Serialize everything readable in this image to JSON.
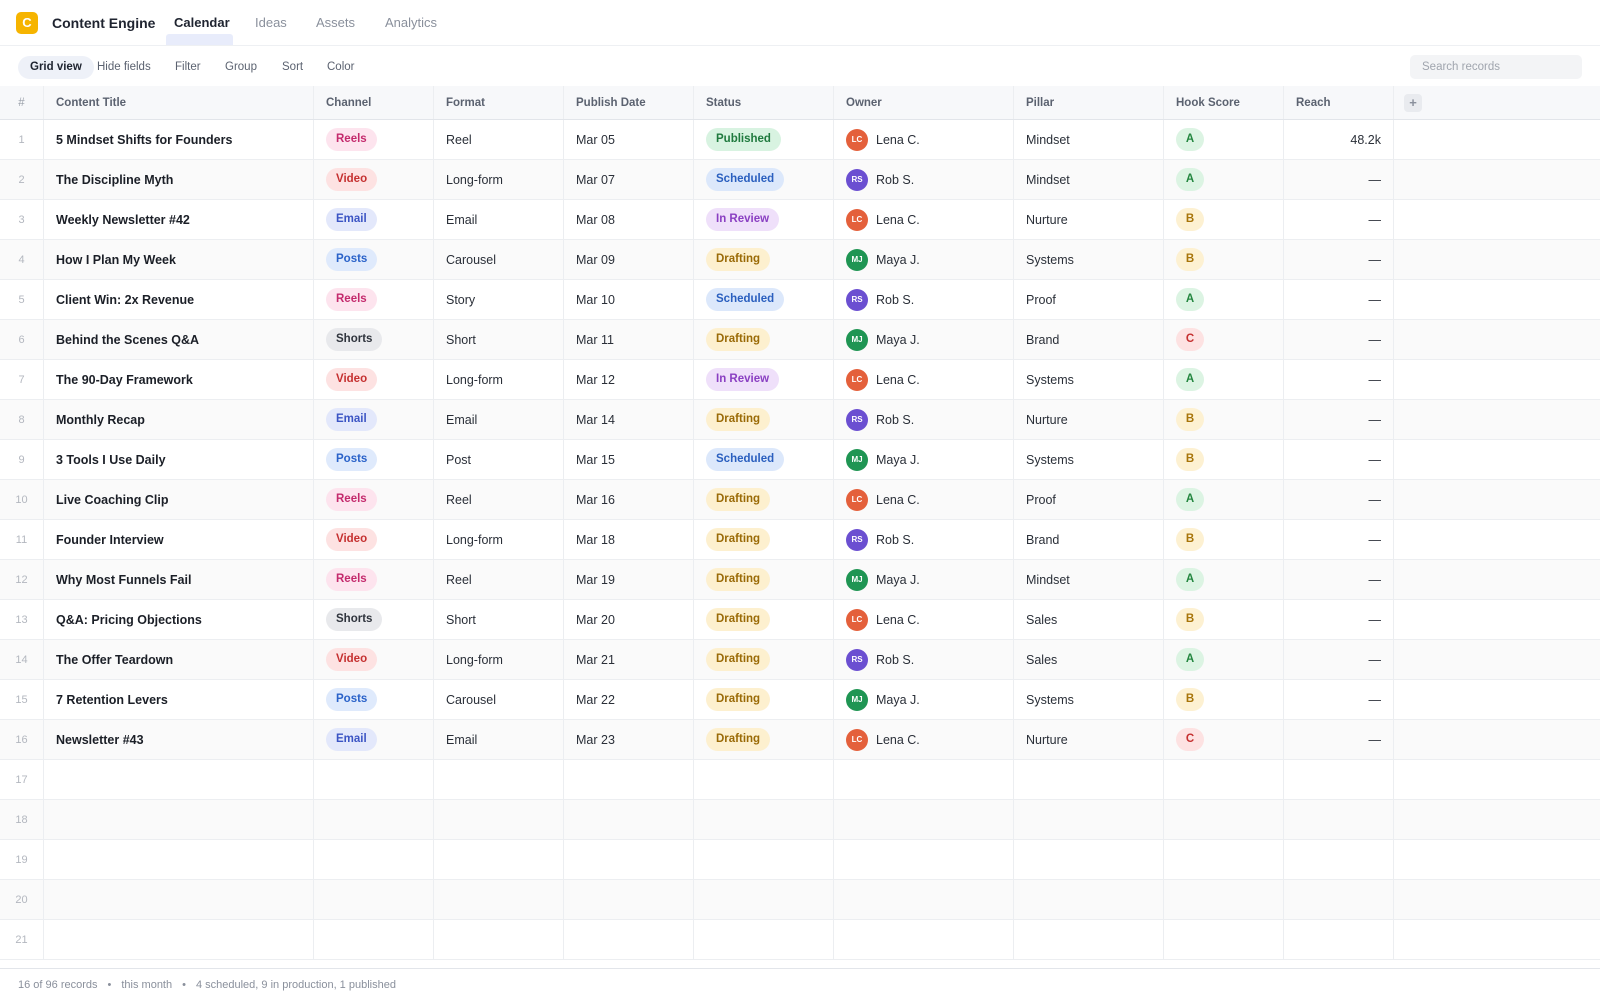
{
  "app": {
    "logo_letter": "C",
    "title": "Content Engine"
  },
  "nav": {
    "tabs": [
      "Calendar",
      "Ideas",
      "Assets",
      "Analytics"
    ],
    "active": 0
  },
  "toolbar": {
    "grid_view": "Grid view",
    "hide_fields": "Hide fields",
    "filter": "Filter",
    "group": "Group",
    "sort": "Sort",
    "color": "Color",
    "search_placeholder": "Search records"
  },
  "columns": [
    "#",
    "Content Title",
    "Channel",
    "Format",
    "Publish Date",
    "Status",
    "Owner",
    "Pillar",
    "Hook Score",
    "Reach"
  ],
  "add_column_label": "+",
  "channel_colors": {
    "Reels": {
      "bg": "#fde4ee",
      "fg": "#c42a6d"
    },
    "Video": {
      "bg": "#fde2e2",
      "fg": "#c53030"
    },
    "Email": {
      "bg": "#e3e8fb",
      "fg": "#3b54c4"
    },
    "Posts": {
      "bg": "#dfeafc",
      "fg": "#2a62c9"
    },
    "Shorts": {
      "bg": "#e8e9ec",
      "fg": "#2f343d"
    }
  },
  "status_colors": {
    "Published": {
      "bg": "#d8f3e1",
      "fg": "#1f7a3e"
    },
    "Scheduled": {
      "bg": "#dce8fb",
      "fg": "#2a5fbf"
    },
    "In Review": {
      "bg": "#efe0fa",
      "fg": "#8a3fc2"
    },
    "Drafting": {
      "bg": "#fdf0cf",
      "fg": "#9a6a06"
    }
  },
  "owner_colors": {
    "LC": "#e4603b",
    "RS": "#6b4fd1",
    "MJ": "#1f9553"
  },
  "score_colors": {
    "A": {
      "bg": "#dcf4e3",
      "fg": "#23863f"
    },
    "B": {
      "bg": "#fdf1d2",
      "fg": "#a77409"
    },
    "C": {
      "bg": "#fde2e2",
      "fg": "#c53030"
    }
  },
  "rows": [
    {
      "num": "1",
      "title": "5 Mindset Shifts for Founders",
      "channel": "Reels",
      "format": "Reel",
      "date": "Mar 05",
      "status": "Published",
      "initials": "LC",
      "owner": "Lena C.",
      "pillar": "Mindset",
      "hook": "A",
      "reach": "48.2k"
    },
    {
      "num": "2",
      "title": "The Discipline Myth",
      "channel": "Video",
      "format": "Long-form",
      "date": "Mar 07",
      "status": "Scheduled",
      "initials": "RS",
      "owner": "Rob S.",
      "pillar": "Mindset",
      "hook": "A",
      "reach": "—"
    },
    {
      "num": "3",
      "title": "Weekly Newsletter #42",
      "channel": "Email",
      "format": "Email",
      "date": "Mar 08",
      "status": "In Review",
      "initials": "LC",
      "owner": "Lena C.",
      "pillar": "Nurture",
      "hook": "B",
      "reach": "—"
    },
    {
      "num": "4",
      "title": "How I Plan My Week",
      "channel": "Posts",
      "format": "Carousel",
      "date": "Mar 09",
      "status": "Drafting",
      "initials": "MJ",
      "owner": "Maya J.",
      "pillar": "Systems",
      "hook": "B",
      "reach": "—"
    },
    {
      "num": "5",
      "title": "Client Win: 2x Revenue",
      "channel": "Reels",
      "format": "Story",
      "date": "Mar 10",
      "status": "Scheduled",
      "initials": "RS",
      "owner": "Rob S.",
      "pillar": "Proof",
      "hook": "A",
      "reach": "—"
    },
    {
      "num": "6",
      "title": "Behind the Scenes Q&A",
      "channel": "Shorts",
      "format": "Short",
      "date": "Mar 11",
      "status": "Drafting",
      "initials": "MJ",
      "owner": "Maya J.",
      "pillar": "Brand",
      "hook": "C",
      "reach": "—"
    },
    {
      "num": "7",
      "title": "The 90-Day Framework",
      "channel": "Video",
      "format": "Long-form",
      "date": "Mar 12",
      "status": "In Review",
      "initials": "LC",
      "owner": "Lena C.",
      "pillar": "Systems",
      "hook": "A",
      "reach": "—"
    },
    {
      "num": "8",
      "title": "Monthly Recap",
      "channel": "Email",
      "format": "Email",
      "date": "Mar 14",
      "status": "Drafting",
      "initials": "RS",
      "owner": "Rob S.",
      "pillar": "Nurture",
      "hook": "B",
      "reach": "—"
    },
    {
      "num": "9",
      "title": "3 Tools I Use Daily",
      "channel": "Posts",
      "format": "Post",
      "date": "Mar 15",
      "status": "Scheduled",
      "initials": "MJ",
      "owner": "Maya J.",
      "pillar": "Systems",
      "hook": "B",
      "reach": "—"
    },
    {
      "num": "10",
      "title": "Live Coaching Clip",
      "channel": "Reels",
      "format": "Reel",
      "date": "Mar 16",
      "status": "Drafting",
      "initials": "LC",
      "owner": "Lena C.",
      "pillar": "Proof",
      "hook": "A",
      "reach": "—"
    },
    {
      "num": "11",
      "title": "Founder Interview",
      "channel": "Video",
      "format": "Long-form",
      "date": "Mar 18",
      "status": "Drafting",
      "initials": "RS",
      "owner": "Rob S.",
      "pillar": "Brand",
      "hook": "B",
      "reach": "—"
    },
    {
      "num": "12",
      "title": "Why Most Funnels Fail",
      "channel": "Reels",
      "format": "Reel",
      "date": "Mar 19",
      "status": "Drafting",
      "initials": "MJ",
      "owner": "Maya J.",
      "pillar": "Mindset",
      "hook": "A",
      "reach": "—"
    },
    {
      "num": "13",
      "title": "Q&A: Pricing Objections",
      "channel": "Shorts",
      "format": "Short",
      "date": "Mar 20",
      "status": "Drafting",
      "initials": "LC",
      "owner": "Lena C.",
      "pillar": "Sales",
      "hook": "B",
      "reach": "—"
    },
    {
      "num": "14",
      "title": "The Offer Teardown",
      "channel": "Video",
      "format": "Long-form",
      "date": "Mar 21",
      "status": "Drafting",
      "initials": "RS",
      "owner": "Rob S.",
      "pillar": "Sales",
      "hook": "A",
      "reach": "—"
    },
    {
      "num": "15",
      "title": "7 Retention Levers",
      "channel": "Posts",
      "format": "Carousel",
      "date": "Mar 22",
      "status": "Drafting",
      "initials": "MJ",
      "owner": "Maya J.",
      "pillar": "Systems",
      "hook": "B",
      "reach": "—"
    },
    {
      "num": "16",
      "title": "Newsletter #43",
      "channel": "Email",
      "format": "Email",
      "date": "Mar 23",
      "status": "Drafting",
      "initials": "LC",
      "owner": "Lena C.",
      "pillar": "Nurture",
      "hook": "C",
      "reach": "—"
    }
  ],
  "empty_rows": [
    "17",
    "18",
    "19",
    "20",
    "21"
  ],
  "footer": {
    "records": "16 of 96 records",
    "period": "this month",
    "summary": "4 scheduled, 9 in production, 1 published",
    "separator": "•"
  }
}
